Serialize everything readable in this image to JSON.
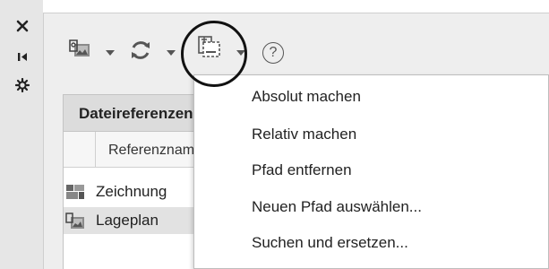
{
  "sidebar": {
    "buttons": [
      {
        "name": "close",
        "glyph": "✕"
      },
      {
        "name": "collapse",
        "glyph": "⇤"
      },
      {
        "name": "settings",
        "glyph": "⚙"
      }
    ]
  },
  "toolbar": {
    "icons": [
      "attach-image-icon",
      "refresh-icon",
      "change-path-icon",
      "help-icon"
    ],
    "help_glyph": "?"
  },
  "section": {
    "header": "Dateireferenzen"
  },
  "table": {
    "column_header": "Referenzname",
    "rows": [
      {
        "label": "Zeichnung",
        "icon": "drawing-icon",
        "selected": false
      },
      {
        "label": "Lageplan",
        "icon": "image-icon",
        "selected": true
      }
    ]
  },
  "menu": {
    "items": [
      "Absolut machen",
      "Relativ machen",
      "Pfad entfernen",
      "Neuen Pfad auswählen...",
      "Suchen und ersetzen..."
    ]
  },
  "colors": {
    "panel_bg": "#eeeeee",
    "sidebar_bg": "#e6e6e6",
    "icon_gray": "#555555",
    "selected_row": "#e2e2e2"
  }
}
